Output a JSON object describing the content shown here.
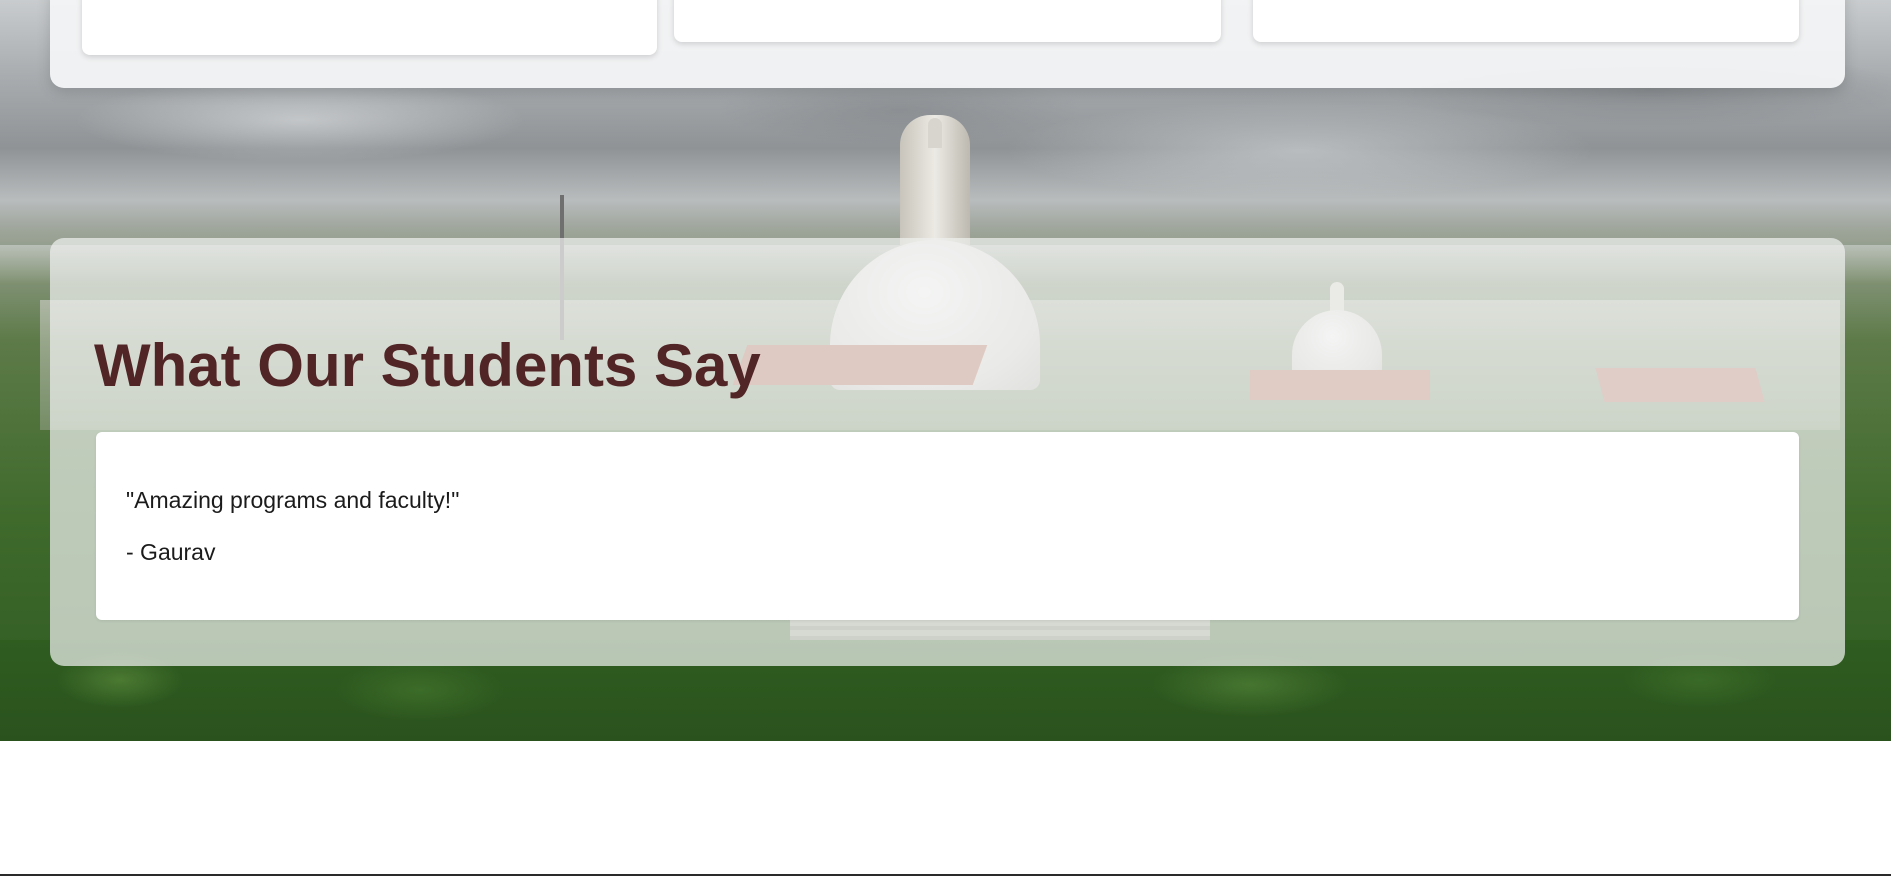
{
  "testimonials": {
    "title": "What Our Students Say",
    "items": [
      {
        "quote": "\"Amazing programs and faculty!\"",
        "author": "- Gaurav"
      }
    ]
  },
  "colors": {
    "title": "#512526",
    "card_background": "#ffffff",
    "section_background": "rgba(238,240,238,0.72)"
  }
}
